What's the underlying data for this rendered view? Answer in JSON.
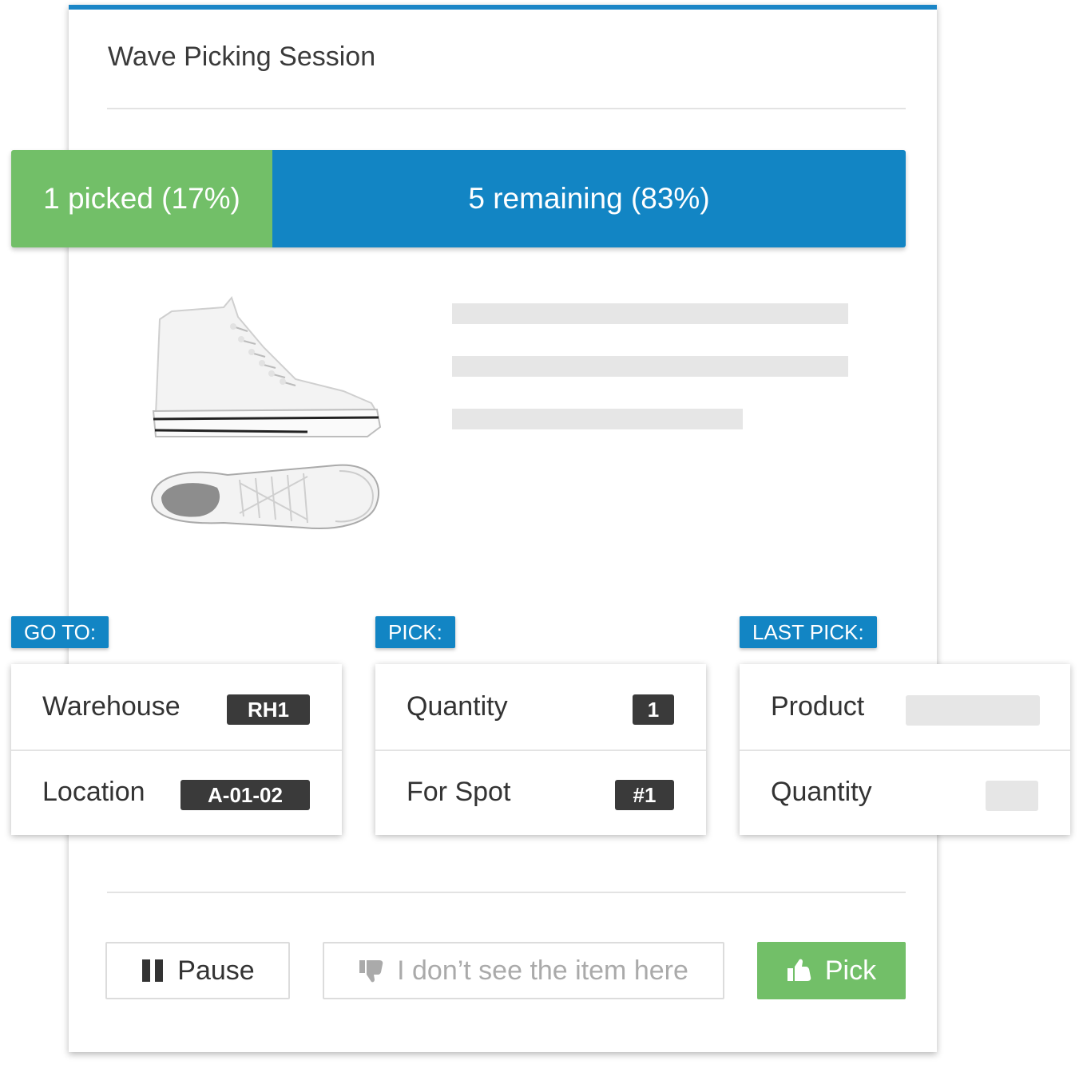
{
  "session": {
    "title": "Wave Picking Session"
  },
  "progress": {
    "picked_label": "1 picked (17%)",
    "remaining_label": "5 remaining (83%)",
    "picked_fraction": 0.17,
    "colors": {
      "picked": "#72bf68",
      "remaining": "#1285c4"
    }
  },
  "goto": {
    "tag": "GO TO:",
    "warehouse_label": "Warehouse",
    "warehouse_value": "RH1",
    "location_label": "Location",
    "location_value": "A-01-02"
  },
  "pick": {
    "tag": "PICK:",
    "quantity_label": "Quantity",
    "quantity_value": "1",
    "spot_label": "For Spot",
    "spot_value": "#1"
  },
  "last_pick": {
    "tag": "LAST PICK:",
    "product_label": "Product",
    "quantity_label": "Quantity"
  },
  "actions": {
    "pause_label": "Pause",
    "pause_icon": "pause-icon",
    "missing_label": "I don’t see the item here",
    "missing_icon": "thumbs-down-icon",
    "pick_label": "Pick",
    "pick_icon": "thumbs-up-icon"
  },
  "colors": {
    "accent": "#1285c4",
    "success": "#72bf68",
    "badge": "#3a3a3a"
  }
}
